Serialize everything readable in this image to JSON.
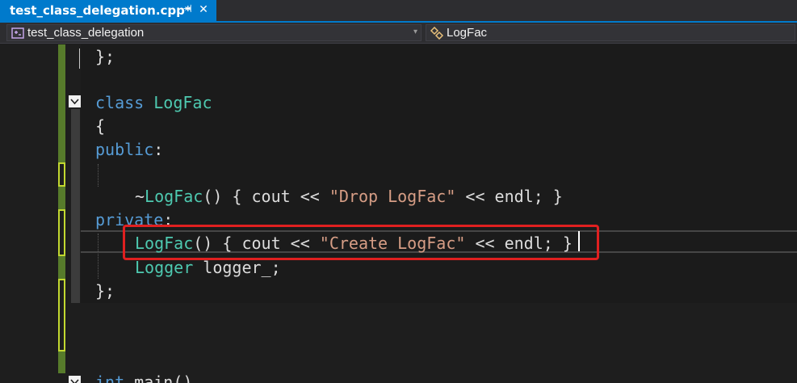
{
  "tab": {
    "title": "test_class_delegation.cpp*",
    "pin_glyph": "⊣",
    "close_glyph": "✕"
  },
  "nav": {
    "scope": "test_class_delegation",
    "member": "LogFac",
    "dropdown_glyph": "▾"
  },
  "code": {
    "lines": [
      {
        "parts": [
          {
            "t": "};",
            "c": "pl"
          }
        ]
      },
      {
        "parts": [
          {
            "t": "class",
            "c": "kw"
          },
          {
            "t": " ",
            "c": "pl"
          },
          {
            "t": "LogFac",
            "c": "ty"
          }
        ]
      },
      {
        "parts": [
          {
            "t": "{",
            "c": "pl"
          }
        ]
      },
      {
        "parts": [
          {
            "t": "public",
            "c": "kw"
          },
          {
            "t": ":",
            "c": "pl"
          }
        ]
      },
      {
        "parts": [
          {
            "t": "~",
            "c": "pl"
          },
          {
            "t": "LogFac",
            "c": "ty"
          },
          {
            "t": "() { cout << ",
            "c": "pl"
          },
          {
            "t": "\"Drop LogFac\"",
            "c": "str"
          },
          {
            "t": " << endl; }",
            "c": "pl"
          }
        ]
      },
      {
        "parts": [
          {
            "t": "private",
            "c": "kw"
          },
          {
            "t": ":",
            "c": "pl"
          }
        ]
      },
      {
        "parts": [
          {
            "t": "LogFac",
            "c": "ty"
          },
          {
            "t": "() { cout << ",
            "c": "pl"
          },
          {
            "t": "\"Create LogFac\"",
            "c": "str"
          },
          {
            "t": " << endl; }",
            "c": "pl"
          }
        ]
      },
      {
        "parts": [
          {
            "t": "Logger",
            "c": "ty"
          },
          {
            "t": " logger_;",
            "c": "pl"
          }
        ]
      },
      {
        "parts": [
          {
            "t": "};",
            "c": "pl"
          }
        ]
      },
      {
        "parts": [
          {
            "t": "int",
            "c": "kw"
          },
          {
            "t": " main()",
            "c": "pl"
          }
        ]
      }
    ]
  },
  "colors": {
    "accent": "#007acc",
    "keyword": "#569cd6",
    "type": "#4ec9b0",
    "string": "#d69d85",
    "text": "#dcdcdc",
    "highlight": "#e02020",
    "change_saved": "#577b2b",
    "change_unsaved": "#c2d830"
  }
}
